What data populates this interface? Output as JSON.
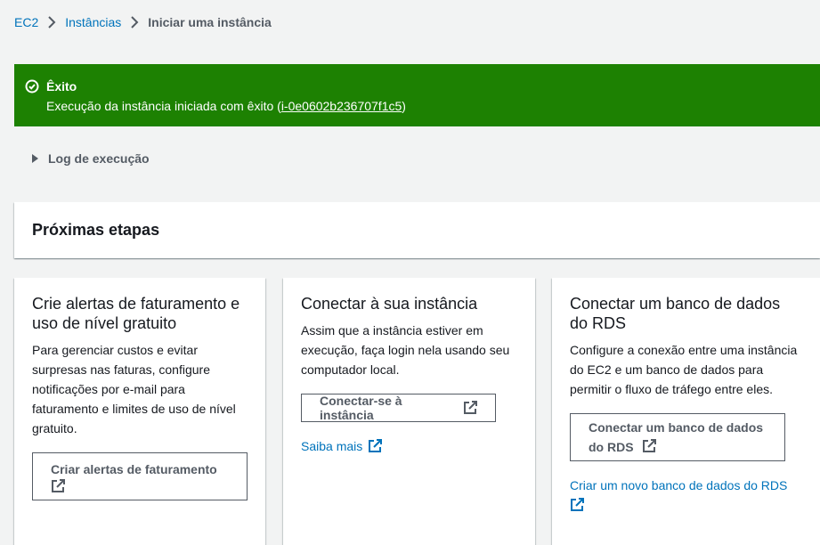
{
  "breadcrumb": {
    "items": [
      {
        "label": "EC2"
      },
      {
        "label": "Instâncias"
      }
    ],
    "current": "Iniciar uma instância"
  },
  "flash": {
    "type": "success",
    "color": "#1d8102",
    "title": "Êxito",
    "message_prefix": "Execução da instância iniciada com êxito (",
    "instance_id": "i-0e0602b236707f1c5",
    "message_suffix": ")"
  },
  "log": {
    "label": "Log de execução",
    "expanded": false
  },
  "next_steps": {
    "title": "Próximas etapas",
    "cards": [
      {
        "title": "Crie alertas de faturamento e uso de nível gratuito",
        "description": "Para gerenciar custos e evitar surpresas nas faturas, configure notificações por e-mail para faturamento e limites de uso de nível gratuito.",
        "button_label": "Criar alertas de faturamento"
      },
      {
        "title": "Conectar à sua instância",
        "description": "Assim que a instância estiver em execução, faça login nela usando seu computador local.",
        "button_label": "Conectar-se à instância",
        "link_label": "Saiba mais"
      },
      {
        "title": "Conectar um banco de dados do RDS",
        "description": "Configure a conexão entre uma instância do EC2 e um banco de dados para permitir o fluxo de tráfego entre eles.",
        "button_label": "Conectar um banco de dados do RDS",
        "link_label": "Criar um novo banco de dados do RDS"
      }
    ]
  },
  "colors": {
    "link": "#0073bb",
    "success": "#1d8102",
    "text_secondary": "#545b64",
    "background": "#f2f3f3"
  },
  "icons": {
    "chevron": "chevron-right-icon",
    "success": "check-circle-icon",
    "caret": "caret-right-icon",
    "external": "external-link-icon"
  }
}
